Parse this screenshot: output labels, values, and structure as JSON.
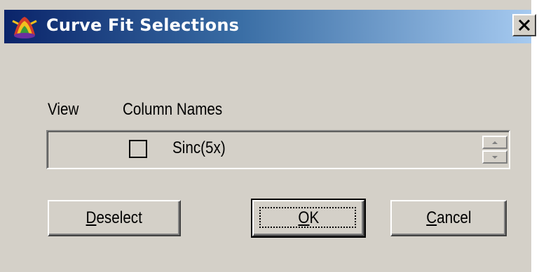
{
  "window": {
    "title": "Curve Fit Selections",
    "close_glyph": "×"
  },
  "header": {
    "view_label": "View",
    "column_names_label": "Column Names"
  },
  "list": {
    "items": [
      {
        "name": "Sinc(5x)",
        "checked": false
      }
    ]
  },
  "buttons": {
    "deselect": {
      "label_first": "D",
      "label_rest": "eselect"
    },
    "ok": {
      "label_first": "O",
      "label_rest": "K"
    },
    "cancel": {
      "label_first": "C",
      "label_rest": "ancel"
    }
  },
  "colors": {
    "titlebar_start": "#0a246a",
    "titlebar_end": "#a6caf0",
    "dialog_bg": "#d4d0c8"
  }
}
